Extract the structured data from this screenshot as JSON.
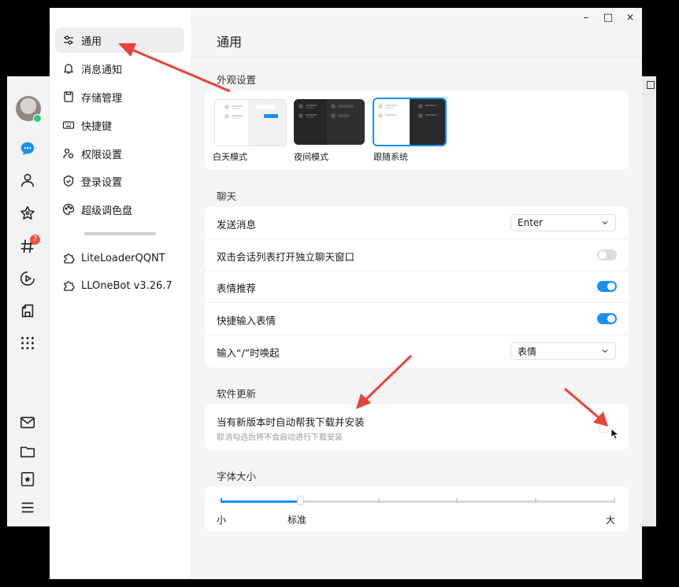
{
  "colors": {
    "accent": "#1a8ff2",
    "annotation_arrow": "#e8423a",
    "badge": "#f0533f",
    "online": "#2ecc71"
  },
  "rail": {
    "icons": [
      "avatar",
      "chat-bubble-icon",
      "contacts-icon",
      "star-icon",
      "hash-icon",
      "video-icon",
      "shop-icon",
      "apps-grid-icon",
      "mail-icon",
      "folder-icon",
      "bookmark-icon",
      "menu-icon"
    ],
    "badge_count": "7"
  },
  "window_controls": {
    "minimize": "–",
    "maximize": "□",
    "close": "×"
  },
  "sidebar": {
    "items": [
      {
        "label": "通用",
        "icon": "sliders-icon",
        "active": true
      },
      {
        "label": "消息通知",
        "icon": "bell-icon"
      },
      {
        "label": "存储管理",
        "icon": "storage-icon"
      },
      {
        "label": "快捷键",
        "icon": "keyboard-icon"
      },
      {
        "label": "权限设置",
        "icon": "permission-icon"
      },
      {
        "label": "登录设置",
        "icon": "login-shield-icon"
      },
      {
        "label": "超级调色盘",
        "icon": "palette-icon"
      }
    ],
    "plugins": [
      {
        "label": "LiteLoaderQQNT",
        "icon": "puzzle-icon"
      },
      {
        "label": "LLOneBot v3.26.7",
        "icon": "puzzle-icon"
      }
    ]
  },
  "page": {
    "title": "通用"
  },
  "appearance": {
    "section_title": "外观设置",
    "themes": [
      {
        "label": "白天模式",
        "selected": false
      },
      {
        "label": "夜间模式",
        "selected": false
      },
      {
        "label": "跟随系统",
        "selected": true
      }
    ]
  },
  "chat": {
    "section_title": "聊天",
    "rows": [
      {
        "label": "发送消息",
        "control": "select",
        "value": "Enter"
      },
      {
        "label": "双击会话列表打开独立聊天窗口",
        "control": "toggle",
        "on": false
      },
      {
        "label": "表情推荐",
        "control": "toggle",
        "on": true
      },
      {
        "label": "快捷输入表情",
        "control": "toggle",
        "on": true
      },
      {
        "label": "输入“/”时唤起",
        "control": "select",
        "value": "表情"
      }
    ]
  },
  "update": {
    "section_title": "软件更新",
    "label": "当有新版本时自动帮我下载并安装",
    "sublabel": "取消勾选后将不会自动进行下载安装",
    "checked": false
  },
  "font_size": {
    "section_title": "字体大小",
    "labels": {
      "min": "小",
      "standard": "标准",
      "max": "大"
    },
    "level": 1,
    "levels": 6
  }
}
